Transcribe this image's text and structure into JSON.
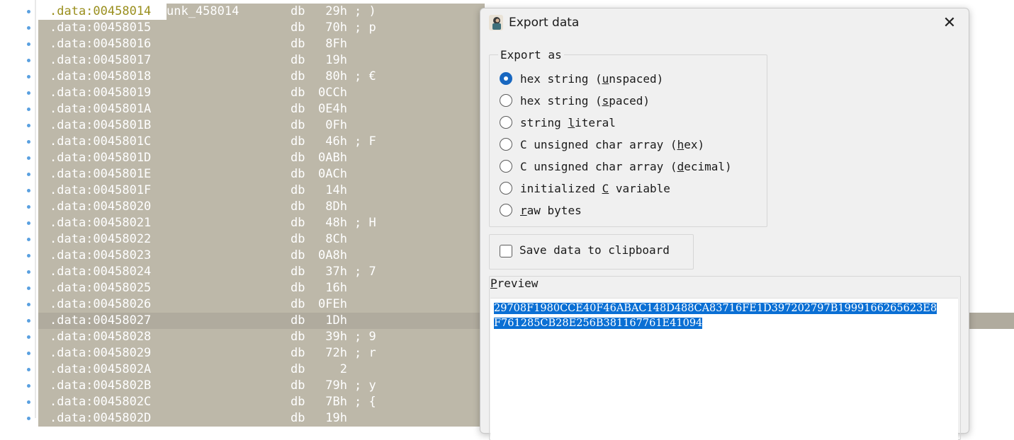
{
  "listing": {
    "first_row": {
      "addr": ".data:00458014",
      "label": "unk_458014",
      "op": "db",
      "val": "29h",
      "cmt": "; )"
    },
    "rows": [
      {
        "addr": ".data:00458015",
        "op": "db",
        "val": "70h",
        "cmt": "; p"
      },
      {
        "addr": ".data:00458016",
        "op": "db",
        "val": "8Fh",
        "cmt": ""
      },
      {
        "addr": ".data:00458017",
        "op": "db",
        "val": "19h",
        "cmt": ""
      },
      {
        "addr": ".data:00458018",
        "op": "db",
        "val": "80h",
        "cmt": "; €"
      },
      {
        "addr": ".data:00458019",
        "op": "db",
        "val": "0CCh",
        "cmt": ""
      },
      {
        "addr": ".data:0045801A",
        "op": "db",
        "val": "0E4h",
        "cmt": ""
      },
      {
        "addr": ".data:0045801B",
        "op": "db",
        "val": "0Fh",
        "cmt": ""
      },
      {
        "addr": ".data:0045801C",
        "op": "db",
        "val": "46h",
        "cmt": "; F"
      },
      {
        "addr": ".data:0045801D",
        "op": "db",
        "val": "0ABh",
        "cmt": ""
      },
      {
        "addr": ".data:0045801E",
        "op": "db",
        "val": "0ACh",
        "cmt": ""
      },
      {
        "addr": ".data:0045801F",
        "op": "db",
        "val": "14h",
        "cmt": ""
      },
      {
        "addr": ".data:00458020",
        "op": "db",
        "val": "8Dh",
        "cmt": ""
      },
      {
        "addr": ".data:00458021",
        "op": "db",
        "val": "48h",
        "cmt": "; H"
      },
      {
        "addr": ".data:00458022",
        "op": "db",
        "val": "8Ch",
        "cmt": ""
      },
      {
        "addr": ".data:00458023",
        "op": "db",
        "val": "0A8h",
        "cmt": ""
      },
      {
        "addr": ".data:00458024",
        "op": "db",
        "val": "37h",
        "cmt": "; 7"
      },
      {
        "addr": ".data:00458025",
        "op": "db",
        "val": "16h",
        "cmt": ""
      },
      {
        "addr": ".data:00458026",
        "op": "db",
        "val": "0FEh",
        "cmt": ""
      },
      {
        "addr": ".data:00458027",
        "op": "db",
        "val": "1Dh",
        "cmt": ""
      },
      {
        "addr": ".data:00458028",
        "op": "db",
        "val": "39h",
        "cmt": "; 9"
      },
      {
        "addr": ".data:00458029",
        "op": "db",
        "val": "72h",
        "cmt": "; r"
      },
      {
        "addr": ".data:0045802A",
        "op": "db",
        "val": "2",
        "cmt": ""
      },
      {
        "addr": ".data:0045802B",
        "op": "db",
        "val": "79h",
        "cmt": "; y"
      },
      {
        "addr": ".data:0045802C",
        "op": "db",
        "val": "7Bh",
        "cmt": "; {"
      },
      {
        "addr": ".data:0045802D",
        "op": "db",
        "val": "19h",
        "cmt": ""
      }
    ],
    "current_row_index": 18,
    "colors": {
      "selection_bg": "#bdb8a9",
      "address_highlight": "#9a8f1e",
      "gutter_dot": "#5aa0e0"
    }
  },
  "dialog": {
    "title": "Export data",
    "close_label": "✕",
    "export_group_label": "Export as",
    "options": [
      {
        "pre": "hex string (",
        "key": "u",
        "post": "nspaced)",
        "checked": true
      },
      {
        "pre": "hex string (",
        "key": "s",
        "post": "paced)",
        "checked": false
      },
      {
        "pre": "string ",
        "key": "l",
        "post": "iteral",
        "checked": false
      },
      {
        "pre": "C unsigned char array (",
        "key": "h",
        "post": "ex)",
        "checked": false
      },
      {
        "pre": "C unsigned char array (",
        "key": "d",
        "post": "ecimal)",
        "checked": false
      },
      {
        "pre": "initialized ",
        "key": "C",
        "post": " variable",
        "checked": false
      },
      {
        "pre": "",
        "key": "r",
        "post": "aw bytes",
        "checked": false
      }
    ],
    "clipboard_label": "Save data to clipboard",
    "clipboard_checked": false,
    "preview_label_key": "P",
    "preview_label_rest": "review",
    "preview_text": "29708F1980CCE40F46ABAC148D488CA83716FE1D397202797B1999166265623E8F761285CB28E256B381167761E41094",
    "accent_color": "#1867c0"
  }
}
